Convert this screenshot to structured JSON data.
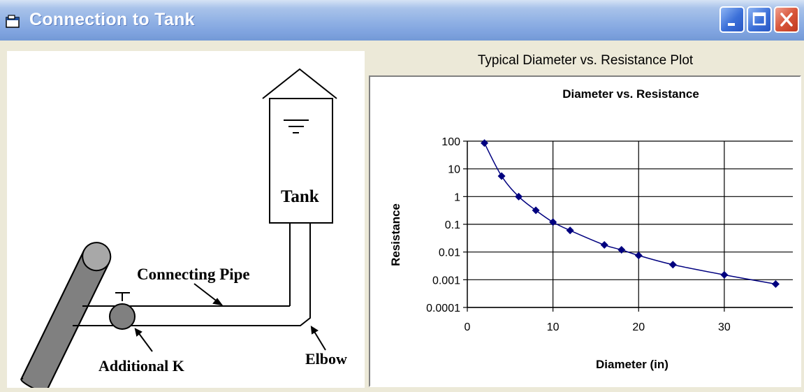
{
  "window": {
    "title": "Connection to Tank",
    "controls": {
      "minimize": "minimize",
      "maximize": "maximize",
      "close": "close"
    }
  },
  "diagram": {
    "labels": {
      "tank": "Tank",
      "connecting_pipe": "Connecting Pipe",
      "additional_k": "Additional K",
      "elbow": "Elbow"
    }
  },
  "chart_panel": {
    "caption": "Typical Diameter vs. Resistance Plot"
  },
  "chart_data": {
    "type": "line",
    "title": "Diameter vs. Resistance",
    "xlabel": "Diameter (in)",
    "ylabel": "Resistance",
    "x_scale": "linear",
    "y_scale": "log",
    "xlim": [
      0,
      38
    ],
    "ylim": [
      0.0001,
      100
    ],
    "x_ticks": [
      0,
      10,
      20,
      30
    ],
    "x_tick_labels": [
      "0",
      "10",
      "20",
      "30"
    ],
    "y_ticks": [
      0.0001,
      0.001,
      0.01,
      0.1,
      1,
      10,
      100
    ],
    "y_tick_labels": [
      "0.0001",
      "0.001",
      "0.01",
      "0.1",
      "1",
      "10",
      "100"
    ],
    "grid": true,
    "marker": "diamond",
    "color": "#00007f",
    "series": [
      {
        "x": [
          2,
          4,
          6,
          8,
          10,
          12,
          16,
          18,
          20,
          24,
          30,
          36
        ],
        "y": [
          85,
          5.5,
          1.0,
          0.32,
          0.12,
          0.06,
          0.018,
          0.012,
          0.0075,
          0.0035,
          0.0015,
          0.0007
        ]
      }
    ]
  }
}
